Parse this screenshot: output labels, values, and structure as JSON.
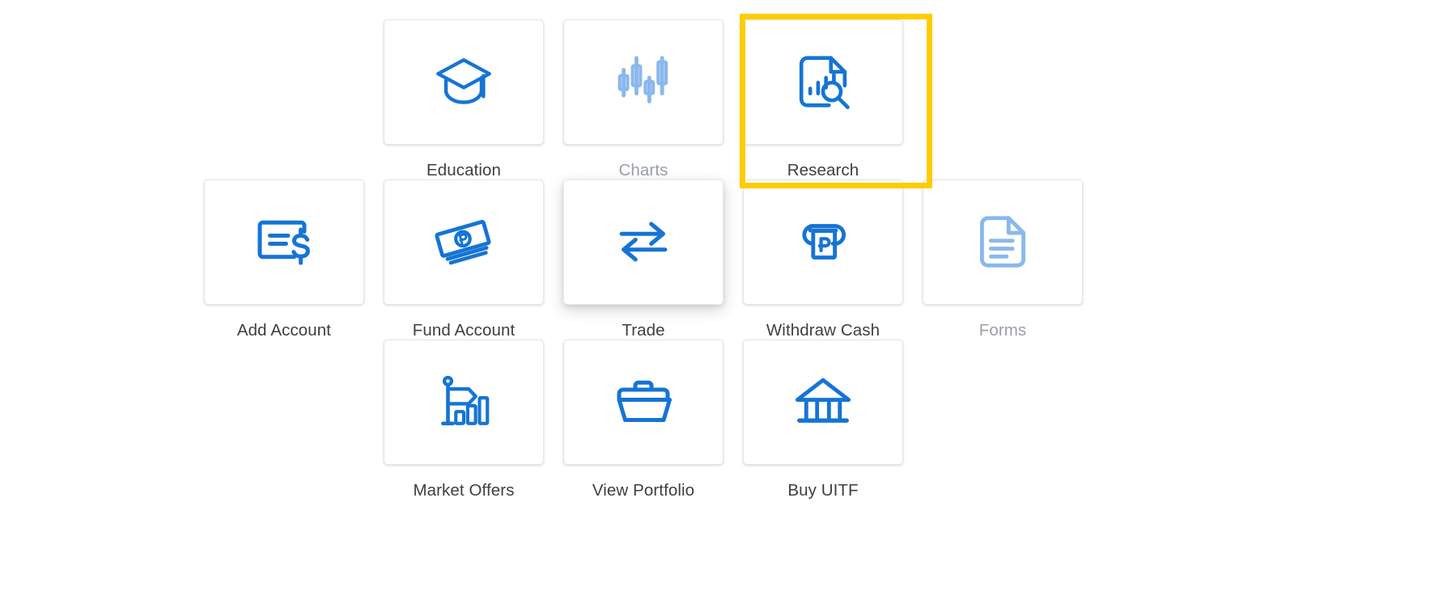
{
  "screen": {
    "title": "Quick Actions Tile Grid",
    "background": "#ffffff",
    "accent_blue": "#1574d5",
    "disabled_blue": "#8ab8ec",
    "label_color": "#3c4043",
    "disabled_label_color": "#9aa0a6",
    "highlight_color": "#FFCC00"
  },
  "rows": [
    {
      "id": "row-1",
      "tiles": [
        {
          "label": "Education",
          "icon": "graduation-cap-icon",
          "state": "enabled",
          "highlighted": false
        },
        {
          "label": "Charts",
          "icon": "candlestick-chart-icon",
          "state": "disabled",
          "highlighted": false
        },
        {
          "label": "Research",
          "icon": "document-chart-search-icon",
          "state": "enabled",
          "highlighted": true
        }
      ]
    },
    {
      "id": "row-2",
      "tiles": [
        {
          "label": "Add Account",
          "icon": "cheque-dollar-icon",
          "state": "enabled",
          "highlighted": false
        },
        {
          "label": "Fund Account",
          "icon": "peso-banknotes-icon",
          "state": "enabled",
          "highlighted": false
        },
        {
          "label": "Trade",
          "icon": "exchange-arrows-icon",
          "state": "hovered",
          "highlighted": false
        },
        {
          "label": "Withdraw Cash",
          "icon": "atm-peso-slot-icon",
          "state": "enabled",
          "highlighted": false
        },
        {
          "label": "Forms",
          "icon": "document-lines-icon",
          "state": "disabled",
          "highlighted": false
        }
      ]
    },
    {
      "id": "row-3",
      "tiles": [
        {
          "label": "Market Offers",
          "icon": "flag-bar-chart-icon",
          "state": "enabled",
          "highlighted": false
        },
        {
          "label": "View Portfolio",
          "icon": "briefcase-folder-icon",
          "state": "enabled",
          "highlighted": false
        },
        {
          "label": "Buy UITF",
          "icon": "bank-building-icon",
          "state": "enabled",
          "highlighted": false
        }
      ]
    }
  ]
}
